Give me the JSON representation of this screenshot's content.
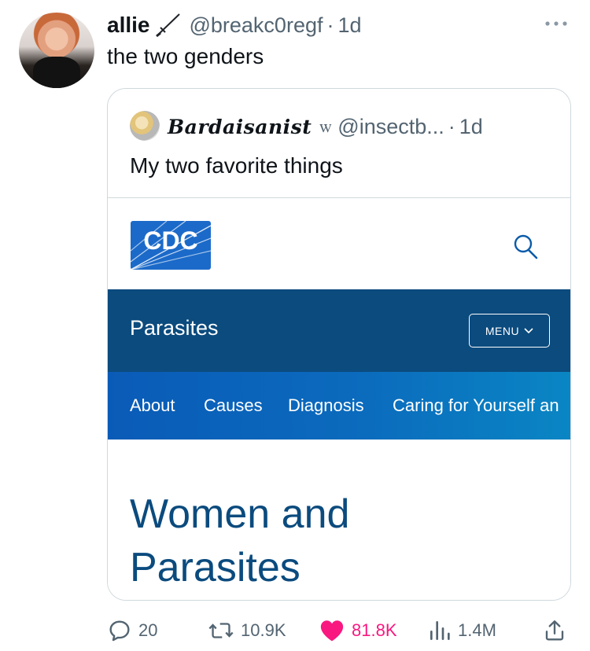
{
  "tweet": {
    "author": {
      "display_name": "allie",
      "handle": "@breakc0regf",
      "time": "1d"
    },
    "text": "the two genders",
    "separator": "·"
  },
  "quoted_tweet": {
    "author": {
      "display_name": "Bardaisanist",
      "name_glyph": "ꮃ",
      "handle": "@insectb...",
      "time": "1d"
    },
    "text": "My two favorite things",
    "media": {
      "logo_text": "CDC",
      "section_title": "Parasites",
      "menu_label": "MENU",
      "nav_items": [
        "About",
        "Causes",
        "Diagnosis",
        "Caring for Yourself an"
      ],
      "article_title_line1": "Women and",
      "article_title_line2": "Parasites",
      "colors": {
        "section_bar": "#0b4b7e",
        "nav_bar": "#0a5bb7",
        "title_text": "#0b4b7e",
        "logo_blue": "#1b6ac9"
      }
    }
  },
  "actions": {
    "replies": "20",
    "reposts": "10.9K",
    "likes": "81.8K",
    "views": "1.4M",
    "liked": true
  },
  "icons": {
    "reply": "reply-icon",
    "repost": "repost-icon",
    "like": "heart-icon",
    "views": "views-icon",
    "share": "share-icon",
    "more": "more-icon",
    "search": "search-icon"
  },
  "colors": {
    "text_primary": "#0f1419",
    "text_secondary": "#536471",
    "like_pink": "#f91880",
    "border": "#cfd9de"
  }
}
